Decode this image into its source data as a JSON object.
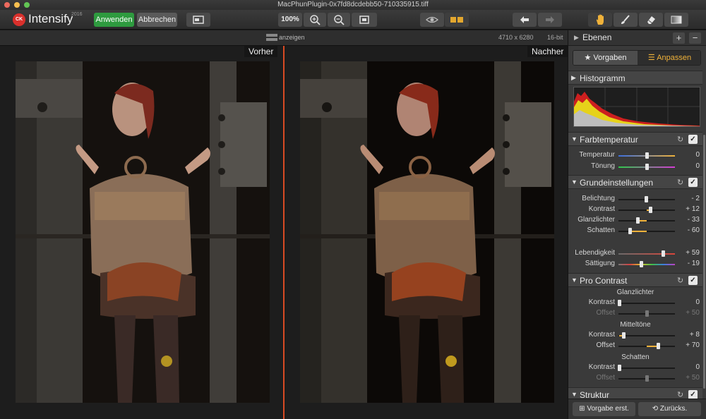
{
  "window": {
    "title": "MacPhunPlugin-0x7fd8dcdebb50-710335915.tiff"
  },
  "toolbar": {
    "logo_text": "CK",
    "app_name": "Intensify",
    "app_year": "2016",
    "apply_label": "Anwenden",
    "cancel_label": "Abbrechen",
    "zoom_label": "100%"
  },
  "subbar": {
    "show_label": "anzeigen",
    "dimensions": "4710 x 6280",
    "bit_depth": "16-bit"
  },
  "canvas": {
    "before_label": "Vorher",
    "after_label": "Nachher"
  },
  "panel": {
    "layers_title": "Ebenen",
    "add_symbol": "+",
    "remove_symbol": "−",
    "tabs": {
      "presets": "Vorgaben",
      "adjust": "Anpassen",
      "active": "adjust"
    },
    "histogram_title": "Histogramm",
    "sections": {
      "color_temp": {
        "title": "Farbtemperatur",
        "rows": [
          {
            "label": "Temperatur",
            "value": "0"
          },
          {
            "label": "Tönung",
            "value": "0"
          }
        ]
      },
      "basic": {
        "title": "Grundeinstellungen",
        "rows": [
          {
            "label": "Belichtung",
            "value": "- 2"
          },
          {
            "label": "Kontrast",
            "value": "+ 12"
          },
          {
            "label": "Glanzlichter",
            "value": "- 33"
          },
          {
            "label": "Schatten",
            "value": "- 60"
          },
          {
            "label": "Lebendigkeit",
            "value": "+ 59"
          },
          {
            "label": "Sättigung",
            "value": "- 19"
          }
        ]
      },
      "pro_contrast": {
        "title": "Pro Contrast",
        "highlights_title": "Glanzlichter",
        "midtones_title": "Mitteltöne",
        "shadows_title": "Schatten",
        "highlights": [
          {
            "label": "Kontrast",
            "value": "0"
          },
          {
            "label": "Offset",
            "value": "+ 50"
          }
        ],
        "midtones": [
          {
            "label": "Kontrast",
            "value": "+ 8"
          },
          {
            "label": "Offset",
            "value": "+ 70"
          }
        ],
        "shadows": [
          {
            "label": "Kontrast",
            "value": "0"
          },
          {
            "label": "Offset",
            "value": "+ 50"
          }
        ]
      },
      "structure": {
        "title": "Struktur"
      }
    },
    "footer": {
      "save_preset": "Vorgabe erst.",
      "reset_all": "Zurücks."
    }
  },
  "colors": {
    "accent": "#f0b23a",
    "apply_green": "#2e9b3f",
    "divider": "#d84a23"
  }
}
